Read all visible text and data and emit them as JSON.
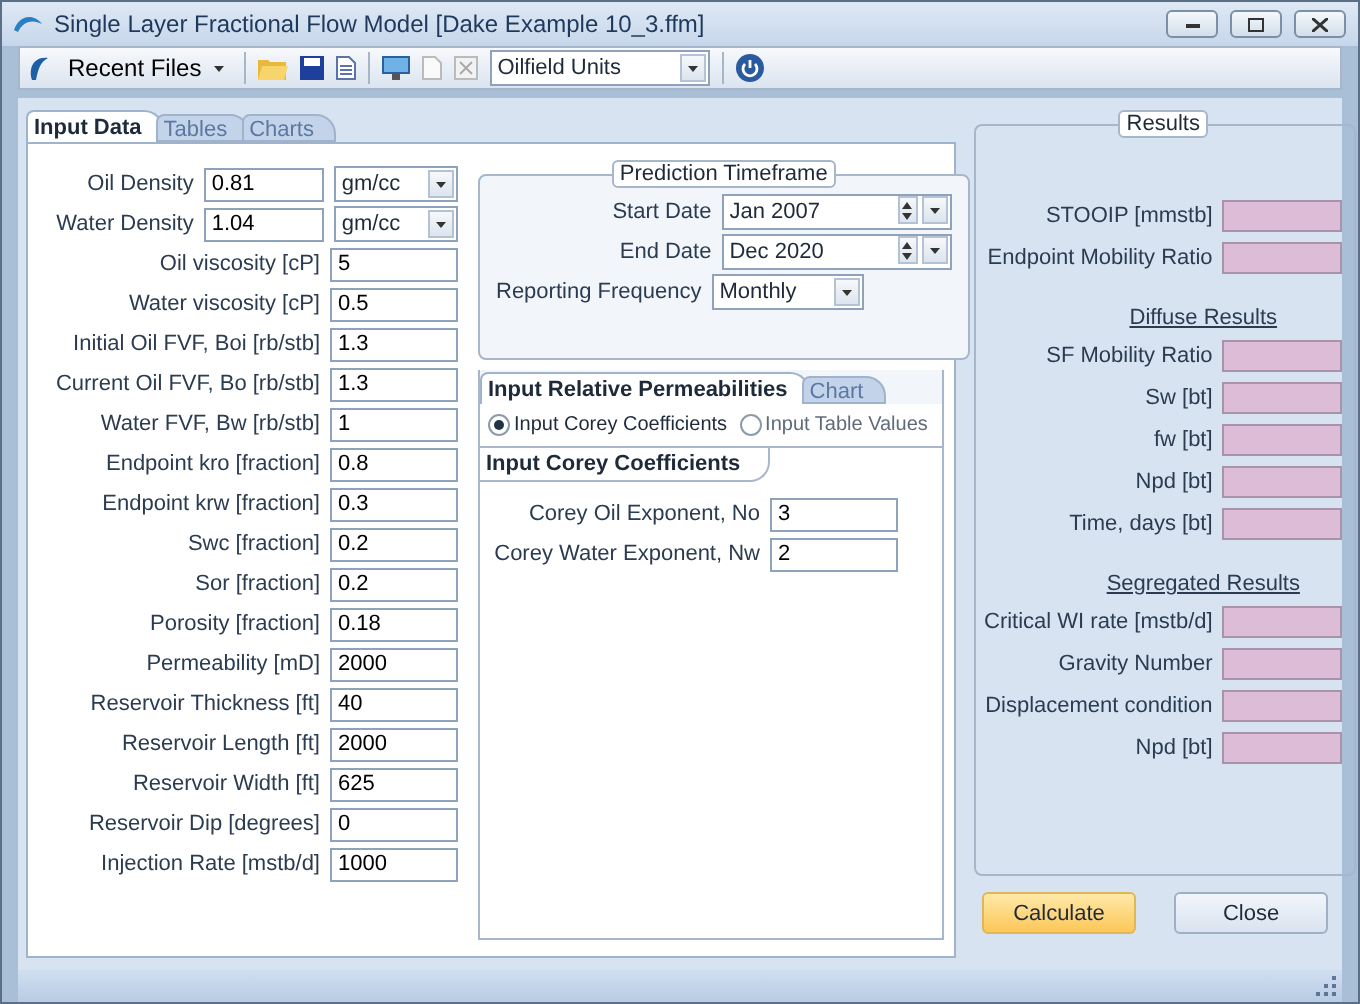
{
  "window": {
    "title": "Single Layer Fractional Flow Model [Dake Example 10_3.ffm]"
  },
  "toolbar": {
    "recent_files": "Recent Files",
    "units": "Oilfield Units"
  },
  "tabs": [
    {
      "label": "Input Data",
      "selected": true
    },
    {
      "label": "Tables",
      "selected": false
    },
    {
      "label": "Charts",
      "selected": false
    }
  ],
  "inputs": [
    {
      "label": "Oil Density",
      "value": "0.81",
      "kind": "unit",
      "unit": "gm/cc"
    },
    {
      "label": "Water Density",
      "value": "1.04",
      "kind": "unit",
      "unit": "gm/cc"
    },
    {
      "label": "Oil viscosity [cP]",
      "value": "5",
      "kind": "plain"
    },
    {
      "label": "Water viscosity [cP]",
      "value": "0.5",
      "kind": "plain"
    },
    {
      "label": "Initial Oil FVF, Boi [rb/stb]",
      "value": "1.3",
      "kind": "plain"
    },
    {
      "label": "Current Oil FVF, Bo [rb/stb]",
      "value": "1.3",
      "kind": "plain"
    },
    {
      "label": "Water FVF, Bw [rb/stb]",
      "value": "1",
      "kind": "plain"
    },
    {
      "label": "Endpoint kro [fraction]",
      "value": "0.8",
      "kind": "plain"
    },
    {
      "label": "Endpoint krw [fraction]",
      "value": "0.3",
      "kind": "plain"
    },
    {
      "label": "Swc [fraction]",
      "value": "0.2",
      "kind": "plain"
    },
    {
      "label": "Sor [fraction]",
      "value": "0.2",
      "kind": "plain"
    },
    {
      "label": "Porosity [fraction]",
      "value": "0.18",
      "kind": "plain"
    },
    {
      "label": "Permeability [mD]",
      "value": "2000",
      "kind": "plain"
    },
    {
      "label": "Reservoir Thickness [ft]",
      "value": "40",
      "kind": "plain"
    },
    {
      "label": "Reservoir Length [ft]",
      "value": "2000",
      "kind": "plain"
    },
    {
      "label": "Reservoir Width [ft]",
      "value": "625",
      "kind": "plain"
    },
    {
      "label": "Reservoir Dip [degrees]",
      "value": "0",
      "kind": "plain"
    },
    {
      "label": "Injection Rate [mstb/d]",
      "value": "1000",
      "kind": "plain"
    }
  ],
  "timeframe": {
    "title": "Prediction Timeframe",
    "fields": [
      {
        "label": "Start Date",
        "value": "Jan 2007",
        "kind": "spin"
      },
      {
        "label": "End Date",
        "value": "Dec 2020",
        "kind": "spin"
      },
      {
        "label": "Reporting Frequency",
        "value": "Monthly",
        "kind": "select"
      }
    ]
  },
  "relperm_tabs": [
    {
      "label": "Input Relative Permeabilities",
      "selected": true
    },
    {
      "label": "Chart",
      "selected": false
    }
  ],
  "relperm_options": [
    {
      "label": "Input Corey Coefficients",
      "selected": true
    },
    {
      "label": "Input Table Values",
      "selected": false
    }
  ],
  "corey": {
    "tab": "Input Corey Coefficients",
    "rows": [
      {
        "label": "Corey Oil Exponent, No",
        "value": "3"
      },
      {
        "label": "Corey Water Exponent, Nw",
        "value": "2"
      }
    ]
  },
  "results": {
    "title": "Results",
    "sections": [
      {
        "rows": [
          "STOOIP [mmstb]",
          "Endpoint Mobility Ratio"
        ]
      },
      {
        "heading": "Diffuse Results",
        "rows": [
          "SF Mobility Ratio",
          "Sw [bt]",
          "fw [bt]",
          "Npd [bt]",
          "Time, days [bt]"
        ]
      },
      {
        "heading": "Segregated Results",
        "rows": [
          "Critical WI rate [mstb/d]",
          "Gravity Number",
          "Displacement condition",
          "Npd [bt]"
        ]
      }
    ]
  },
  "buttons": [
    {
      "label": "Calculate",
      "kind": "primary"
    },
    {
      "label": "Close",
      "kind": "normal"
    }
  ]
}
